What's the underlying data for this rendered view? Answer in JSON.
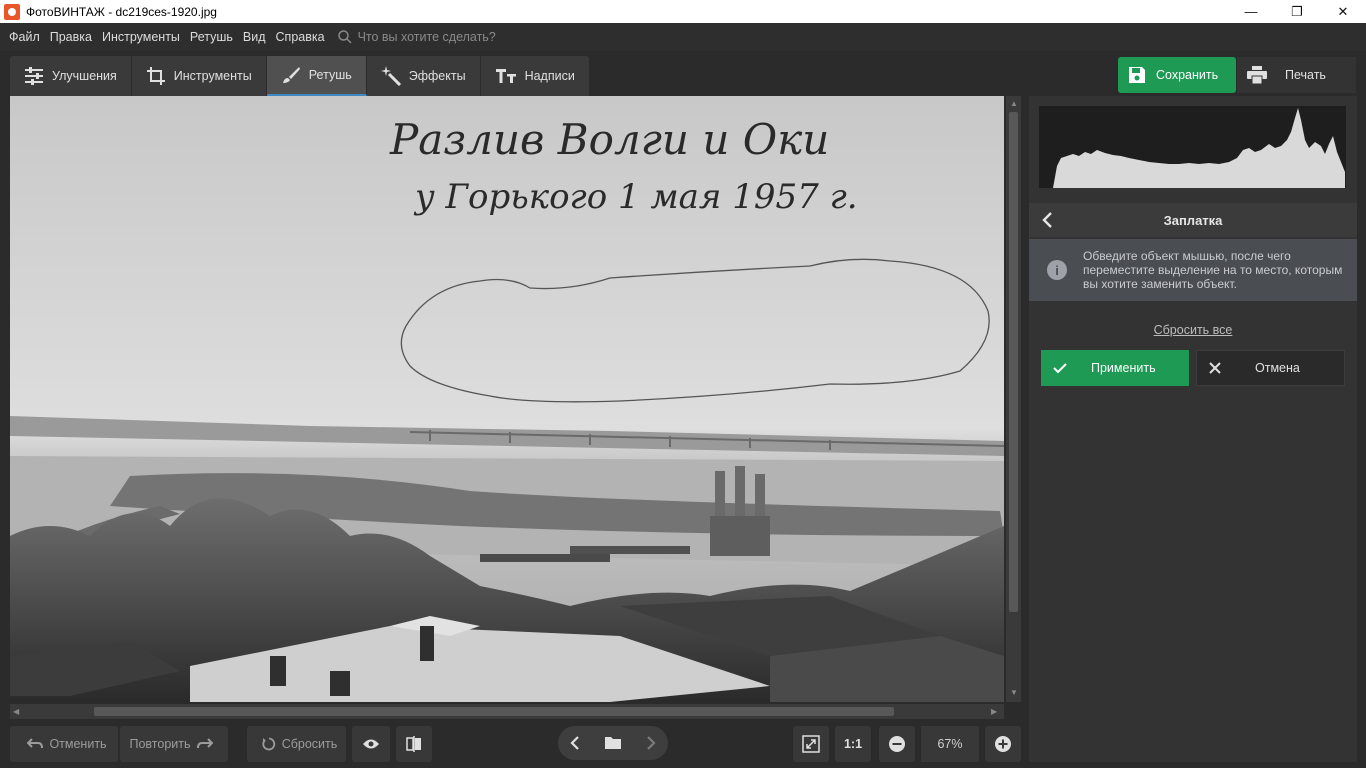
{
  "window": {
    "title": "ФотоВИНТАЖ - dc219ces-1920.jpg",
    "controls": [
      "—",
      "❐",
      "✕"
    ]
  },
  "menu": {
    "items": [
      "Файл",
      "Правка",
      "Инструменты",
      "Ретушь",
      "Вид",
      "Справка"
    ],
    "search_placeholder": "Что вы хотите сделать?"
  },
  "tabs": [
    {
      "label": "Улучшения",
      "icon": "sliders-icon"
    },
    {
      "label": "Инструменты",
      "icon": "crop-icon"
    },
    {
      "label": "Ретушь",
      "icon": "brush-icon",
      "active": true
    },
    {
      "label": "Эффекты",
      "icon": "magic-wand-icon"
    },
    {
      "label": "Надписи",
      "icon": "text-icon"
    }
  ],
  "toolbar": {
    "save_label": "Сохранить",
    "print_label": "Печать"
  },
  "photo": {
    "caption_line1": "Разлив Волги и Оки",
    "caption_line2": "у Горького 1 мая 1957 г."
  },
  "panel": {
    "title": "Заплатка",
    "info_text": "Обведите объект мышью, после чего переместите выделение на то место, которым вы хотите заменить объект.",
    "reset_all": "Сбросить все",
    "apply_label": "Применить",
    "cancel_label": "Отмена"
  },
  "bottom": {
    "undo_label": "Отменить",
    "redo_label": "Повторить",
    "reset_label": "Сбросить",
    "one_to_one": "1:1",
    "zoom": "67%"
  },
  "colors": {
    "accent_green": "#1f9a55",
    "tab_active_underline": "#3f88c5",
    "background": "#2b2b2b"
  }
}
